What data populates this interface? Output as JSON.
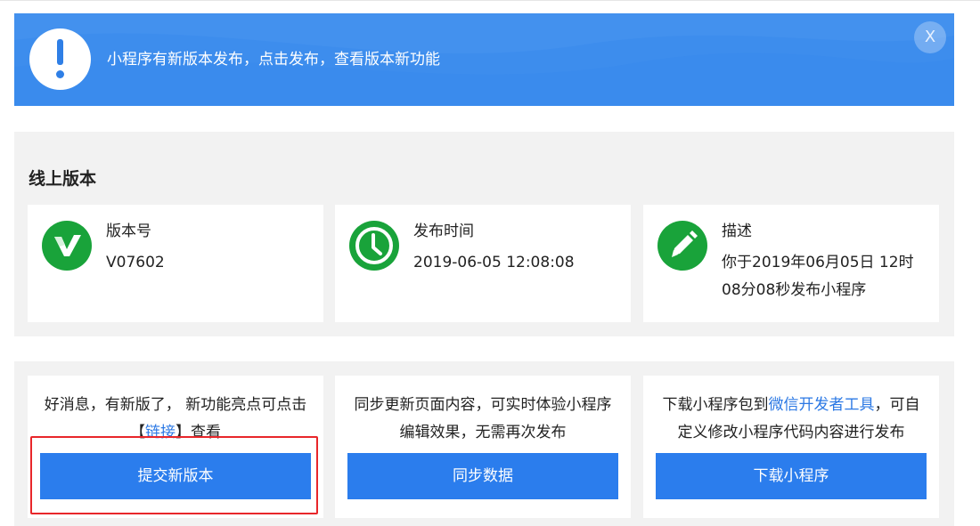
{
  "banner": {
    "message": "小程序有新版本发布，点击发布，查看版本新功能",
    "close_label": "X"
  },
  "online_version": {
    "title": "线上版本",
    "cards": [
      {
        "icon": "version-v-icon",
        "label": "版本号",
        "value": "V07602"
      },
      {
        "icon": "clock-icon",
        "label": "发布时间",
        "value": "2019-06-05 12:08:08"
      },
      {
        "icon": "pencil-icon",
        "label": "描述",
        "value": "你于2019年06月05日 12时08分08秒发布小程序"
      }
    ]
  },
  "actions": {
    "submit": {
      "desc_before": "好消息，有新版了， 新功能亮点可点击【",
      "desc_link": "链接",
      "desc_after": "】查看",
      "button": "提交新版本"
    },
    "sync": {
      "desc": "同步更新页面内容，可实时体验小程序编辑效果，无需再次发布",
      "button": "同步数据"
    },
    "download": {
      "desc_before": "下载小程序包到",
      "desc_link": "微信开发者工具",
      "desc_after": "，可自定义修改小程序代码内容进行发布",
      "button": "下载小程序"
    }
  },
  "colors": {
    "banner_blue": "#3a8bed",
    "button_blue": "#2b7ded",
    "icon_green": "#19a33a",
    "link_blue": "#2b78e4",
    "highlight_red": "#e8262a"
  }
}
